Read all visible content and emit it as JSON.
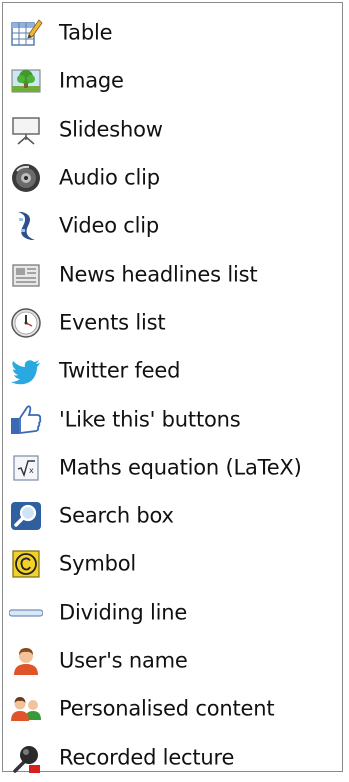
{
  "menu": {
    "items": [
      {
        "label": "Table",
        "icon": "table-icon"
      },
      {
        "label": "Image",
        "icon": "image-icon"
      },
      {
        "label": "Slideshow",
        "icon": "slideshow-icon"
      },
      {
        "label": "Audio clip",
        "icon": "audio-icon"
      },
      {
        "label": "Video clip",
        "icon": "video-icon"
      },
      {
        "label": "News headlines list",
        "icon": "news-icon"
      },
      {
        "label": "Events list",
        "icon": "clock-icon"
      },
      {
        "label": "Twitter feed",
        "icon": "twitter-bird-icon"
      },
      {
        "label": "'Like this' buttons",
        "icon": "thumbs-up-icon"
      },
      {
        "label": "Maths equation (LaTeX)",
        "icon": "equation-icon"
      },
      {
        "label": "Search box",
        "icon": "search-icon"
      },
      {
        "label": "Symbol",
        "icon": "copyright-symbol-icon"
      },
      {
        "label": "Dividing line",
        "icon": "dividing-line-icon"
      },
      {
        "label": "User's name",
        "icon": "user-icon"
      },
      {
        "label": "Personalised content",
        "icon": "users-group-icon"
      },
      {
        "label": "Recorded lecture",
        "icon": "microphone-icon"
      }
    ]
  },
  "colors": {
    "border": "#8a8a8a",
    "text": "#111111",
    "twitter_blue": "#2aa9e0",
    "thumb_blue": "#3b6ab5",
    "symbol_yellow": "#f2d22a"
  }
}
